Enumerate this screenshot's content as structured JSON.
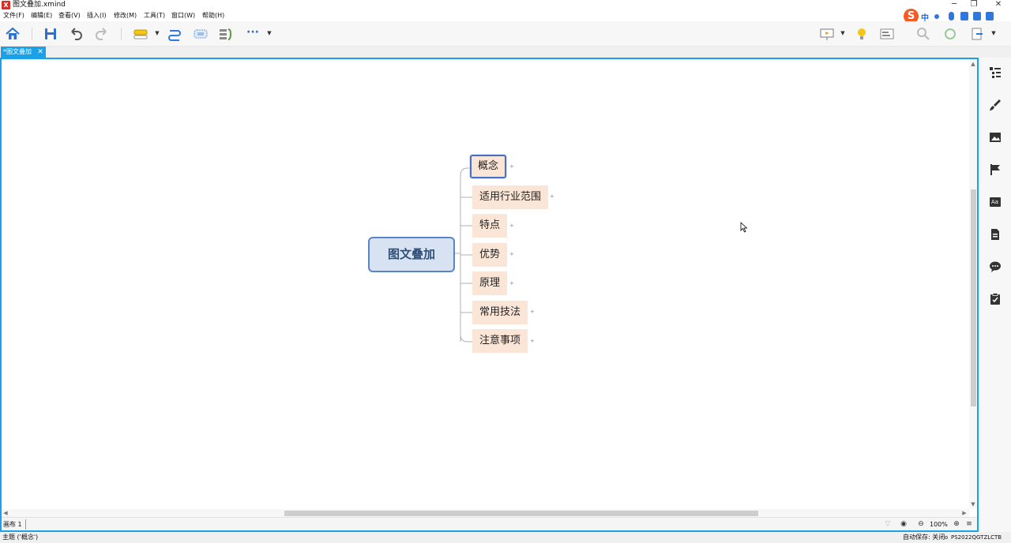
{
  "window": {
    "title": "图文叠加.xmind",
    "logo_text": "X",
    "controls": [
      "─",
      "❐",
      "✕"
    ]
  },
  "menubar": {
    "items": [
      "文件(F)",
      "编辑(E)",
      "查看(V)",
      "插入(I)",
      "修改(M)",
      "工具(T)",
      "窗口(W)",
      "帮助(H)"
    ]
  },
  "ime": {
    "logo": "S",
    "mode": "中"
  },
  "toolbar": {
    "icons": [
      "home-icon",
      "save-icon",
      "undo-icon",
      "redo-icon",
      "topic-insert-icon",
      "relationship-icon",
      "boundary-icon",
      "summary-icon",
      "more-icon"
    ],
    "more_label": "···",
    "right_icons": [
      "presentation-icon",
      "brainstorm-icon",
      "outline-icon",
      "zoom-icon",
      "share-icon",
      "export-icon"
    ]
  },
  "tab": {
    "label": "*图文叠加",
    "close": "✕"
  },
  "mindmap": {
    "root": "图文叠加",
    "subtopics": [
      "概念",
      "适用行业范围",
      "特点",
      "优势",
      "原理",
      "常用技法",
      "注意事项"
    ],
    "selected_index": 0,
    "colors": {
      "root_fill": "#d7e3f3",
      "root_border": "#5a84c5",
      "sub_fill": "#fbe5d6",
      "line": "#b0b0b0",
      "selection": "#4570c4"
    }
  },
  "editor_status": {
    "sheet": "画布 1",
    "zoom": "100%",
    "filter_icon": "filter-icon",
    "eye_icon": "eye-icon",
    "zoom_out": "⊖",
    "zoom_in": "⊕",
    "menu_icon": "≡"
  },
  "right_panel": {
    "icons": [
      "outline-panel-icon",
      "format-brush-icon",
      "image-icon",
      "flag-icon",
      "text-style-icon",
      "notes-icon",
      "comment-icon",
      "task-icon"
    ]
  },
  "status": {
    "left": "主题 ('概念')",
    "autosave": "自动保存: 关闭",
    "license": "PS2022QGTZLCTB"
  },
  "accent": "#1aa1e8"
}
